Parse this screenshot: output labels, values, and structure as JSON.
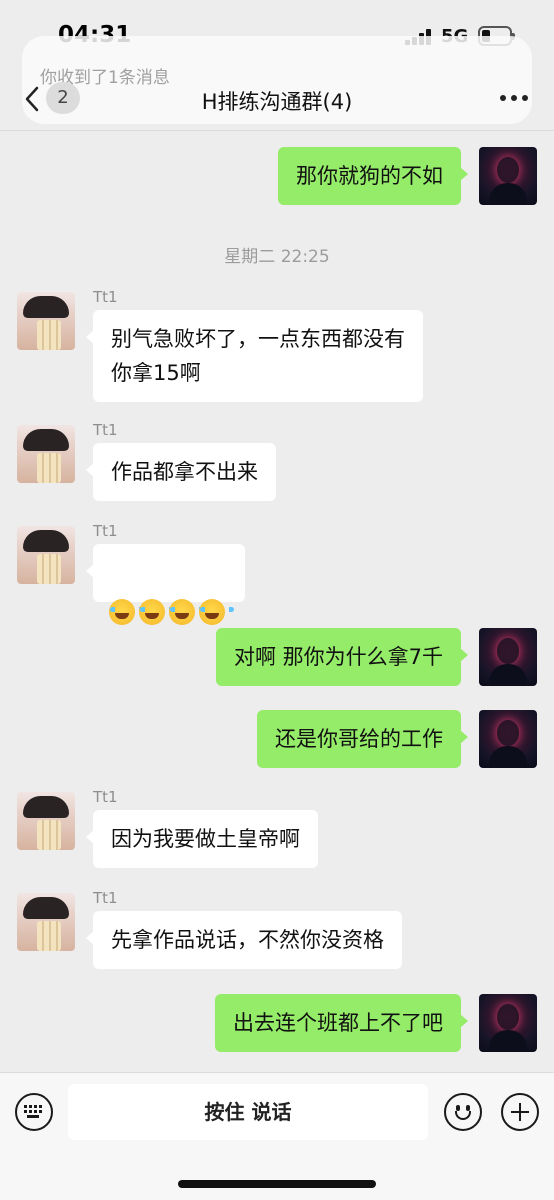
{
  "status_bar": {
    "time": "04:31",
    "network": "5G"
  },
  "notification": {
    "text": "你收到了1条消息"
  },
  "nav": {
    "unread_count": "2",
    "title": "H排练沟通群(4)"
  },
  "timestamp": "星期二 22:25",
  "messages": [
    {
      "from": "self",
      "text": "那你就狗的不如"
    },
    {
      "from": "other",
      "sender": "Tt1",
      "text": "别气急败坏了，一点东西都没有\n你拿15啊"
    },
    {
      "from": "other",
      "sender": "Tt1",
      "text": "作品都拿不出来"
    },
    {
      "from": "other",
      "sender": "Tt1",
      "emoji": [
        "laugh-cry-emoji",
        "laugh-cry-emoji",
        "laugh-cry-emoji",
        "laugh-cry-emoji"
      ]
    },
    {
      "from": "self",
      "text": "对啊 那你为什么拿7千"
    },
    {
      "from": "self",
      "text": "还是你哥给的工作"
    },
    {
      "from": "other",
      "sender": "Tt1",
      "text": "因为我要做土皇帝啊"
    },
    {
      "from": "other",
      "sender": "Tt1",
      "text": "先拿作品说话，不然你没资格"
    },
    {
      "from": "self",
      "text": "出去连个班都上不了吧"
    }
  ],
  "input_bar": {
    "voice_label": "按住 说话",
    "left_icon": "keyboard-icon",
    "emoji_icon": "smiley-icon",
    "plus_icon": "plus-icon"
  },
  "colors": {
    "self_bubble": "#95ec69",
    "other_bubble": "#ffffff",
    "background": "#ededed"
  }
}
